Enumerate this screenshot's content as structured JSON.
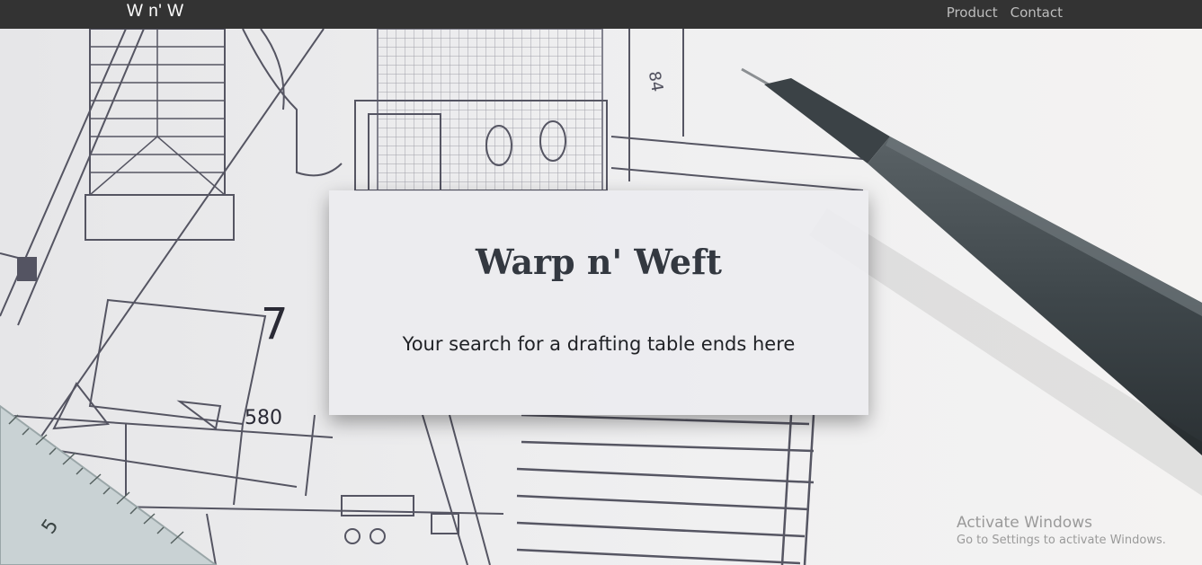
{
  "navbar": {
    "brand": "W n' W",
    "links": [
      {
        "label": "Product"
      },
      {
        "label": "Contact"
      }
    ],
    "background": "#333333"
  },
  "hero": {
    "background_image": "architectural-blueprint-with-pen",
    "card": {
      "title": "Warp n' Weft",
      "subtitle": "Your search for a drafting table ends here"
    },
    "blueprint_labels": {
      "room_number": "7",
      "dimension": "580",
      "ruler_mark": "5",
      "corner_note": "84"
    }
  },
  "watermark": {
    "title": "Activate Windows",
    "subtitle": "Go to Settings to activate Windows."
  }
}
